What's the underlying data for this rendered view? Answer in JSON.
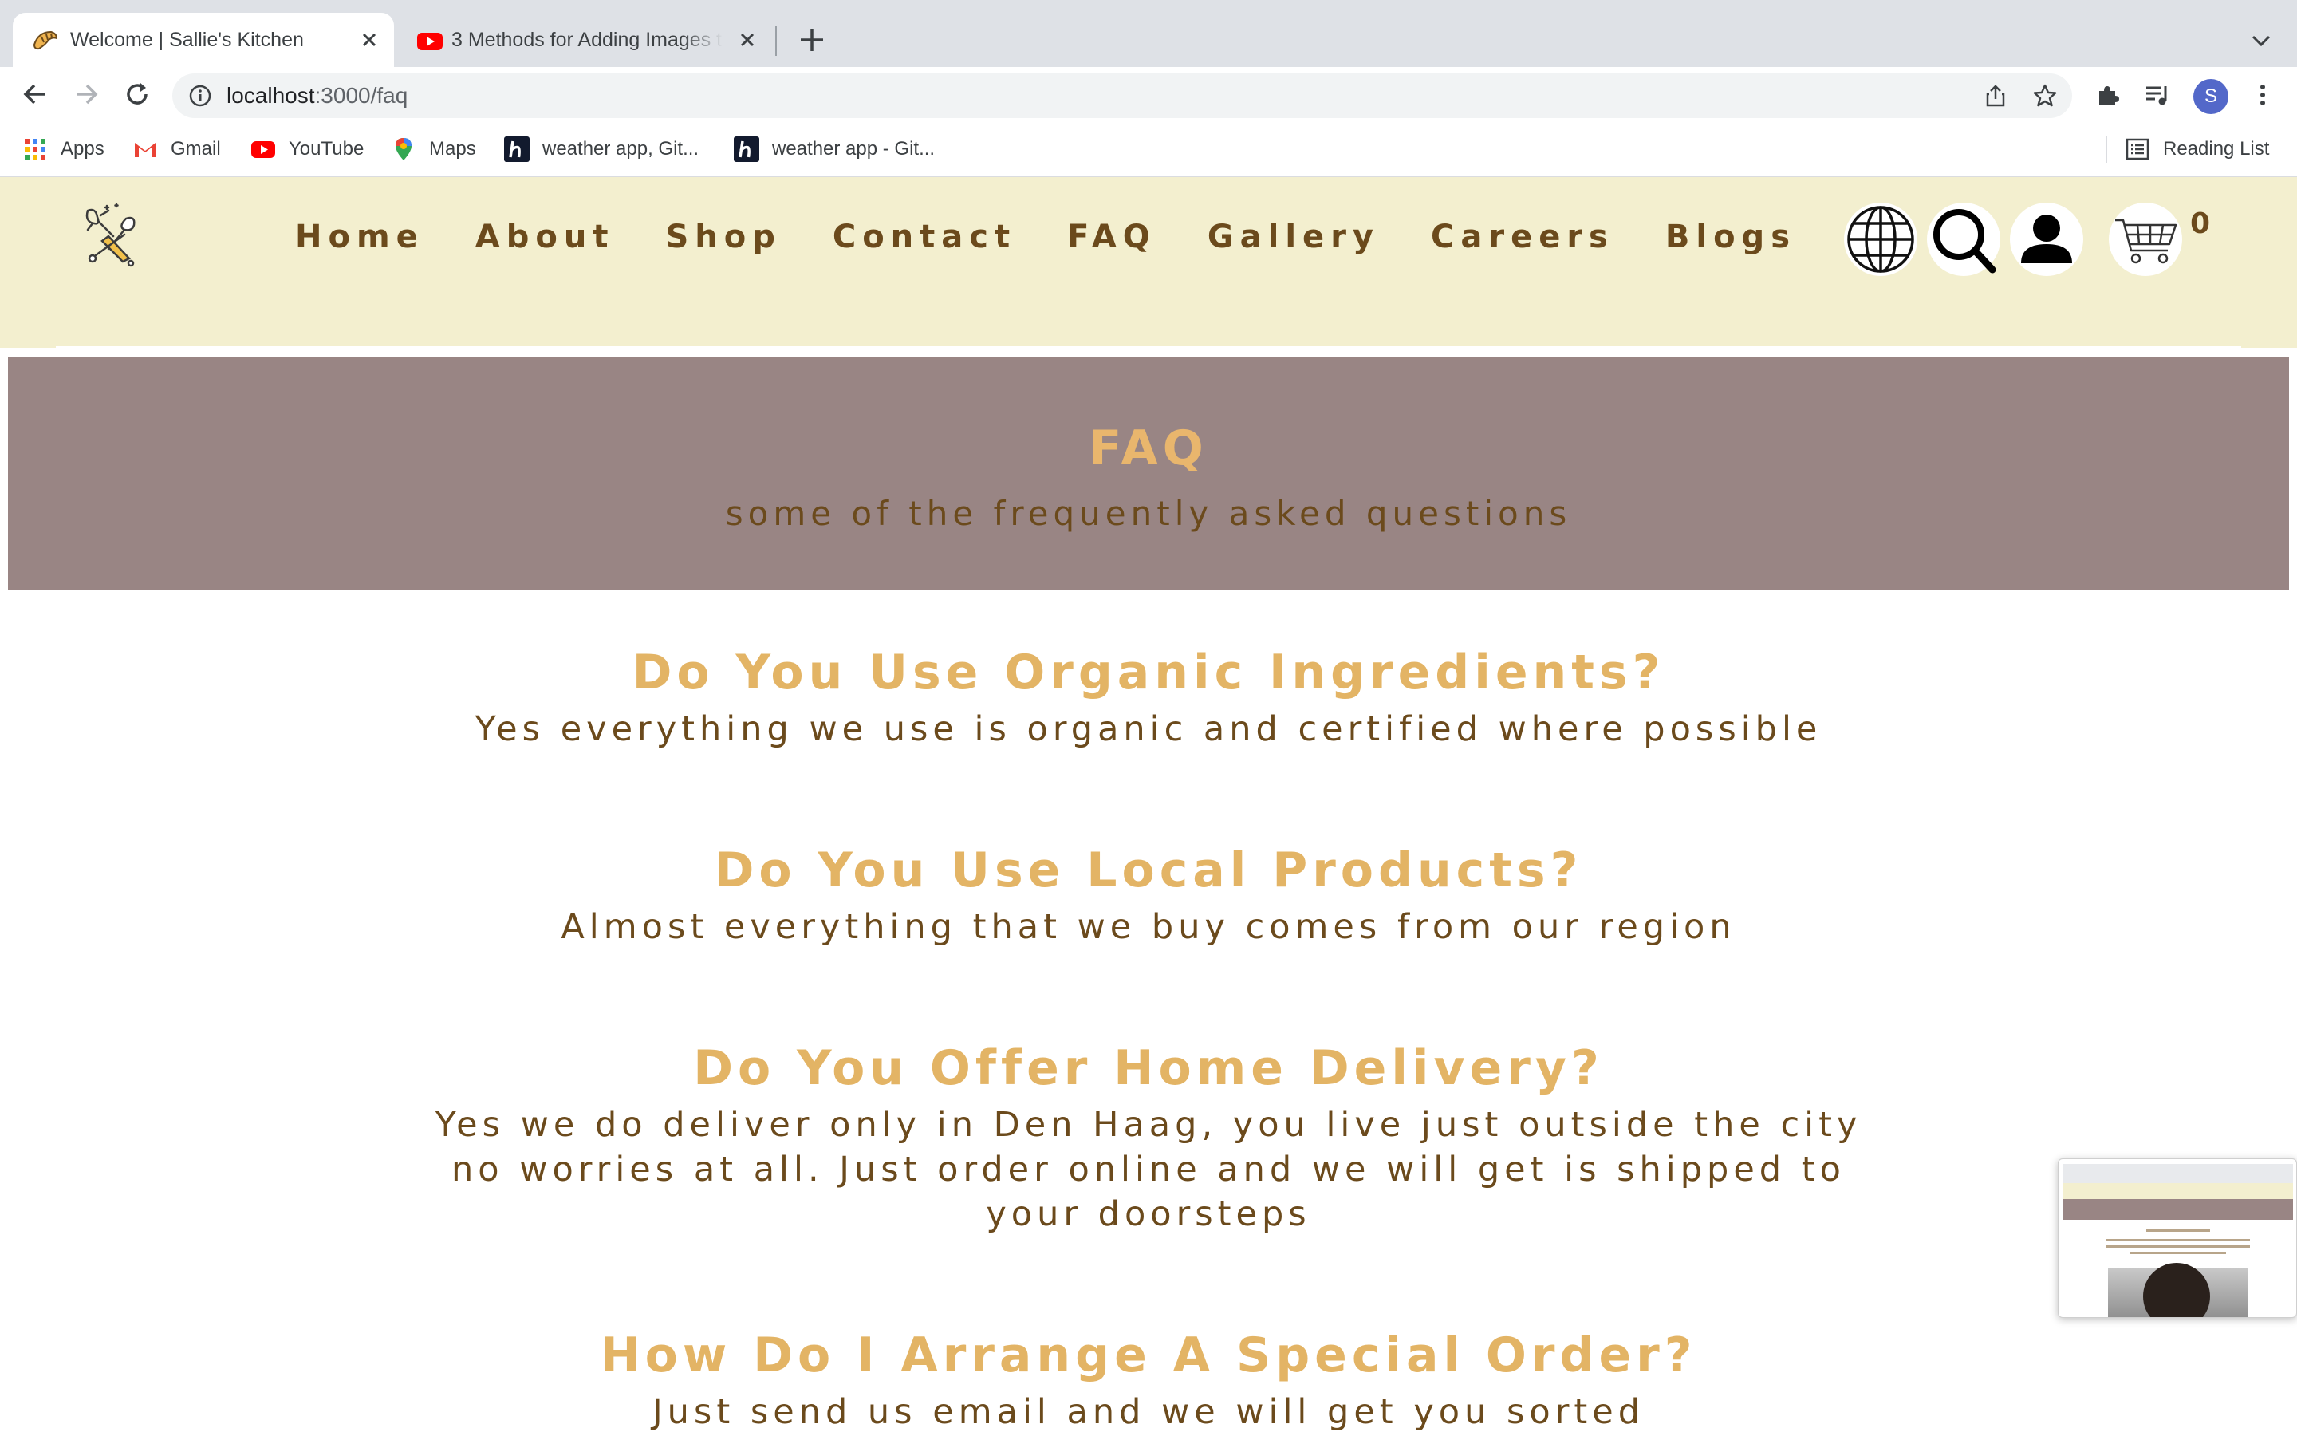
{
  "browser": {
    "tabs": [
      {
        "title": "Welcome | Sallie's Kitchen",
        "active": true
      },
      {
        "title": "3 Methods for Adding Images t",
        "active": false
      }
    ],
    "address": {
      "host": "localhost",
      "path": ":3000/faq"
    },
    "bookmarks": [
      {
        "label": "Apps",
        "icon": "apps-grid-icon"
      },
      {
        "label": "Gmail",
        "icon": "gmail-icon"
      },
      {
        "label": "YouTube",
        "icon": "youtube-icon"
      },
      {
        "label": "Maps",
        "icon": "maps-icon"
      },
      {
        "label": "weather app, Git...",
        "icon": "h-site-icon"
      },
      {
        "label": "weather app - Git...",
        "icon": "h-site-icon"
      }
    ],
    "reading_list": "Reading List",
    "profile_initial": "S"
  },
  "site": {
    "nav": [
      "Home",
      "About",
      "Shop",
      "Contact",
      "FAQ",
      "Gallery",
      "Careers",
      "Blogs"
    ],
    "cart_count": "0",
    "header_icons": [
      "globe-icon",
      "search-icon",
      "user-icon",
      "cart-icon"
    ]
  },
  "banner": {
    "title": "FAQ",
    "subtitle": "some of the frequently asked questions"
  },
  "faq": [
    {
      "q": "Do You Use Organic Ingredients?",
      "a": [
        "Yes everything we use is organic and certified where possible"
      ]
    },
    {
      "q": "Do You Use Local Products?",
      "a": [
        "Almost everything that we buy comes from our region"
      ]
    },
    {
      "q": "Do You Offer Home Delivery?",
      "a": [
        "Yes we do deliver only in Den Haag, you live just outside the city",
        "no worries at all. Just order online and we will get is shipped to",
        "your doorsteps"
      ]
    },
    {
      "q": "How Do I Arrange A Special Order?",
      "a": [
        "Just send us email and we will get you sorted"
      ]
    }
  ],
  "colors": {
    "header_bg": "#f3efcf",
    "nav_text": "#6b4a1c",
    "banner_bg": "#998584",
    "accent_gold": "#e3b465"
  }
}
